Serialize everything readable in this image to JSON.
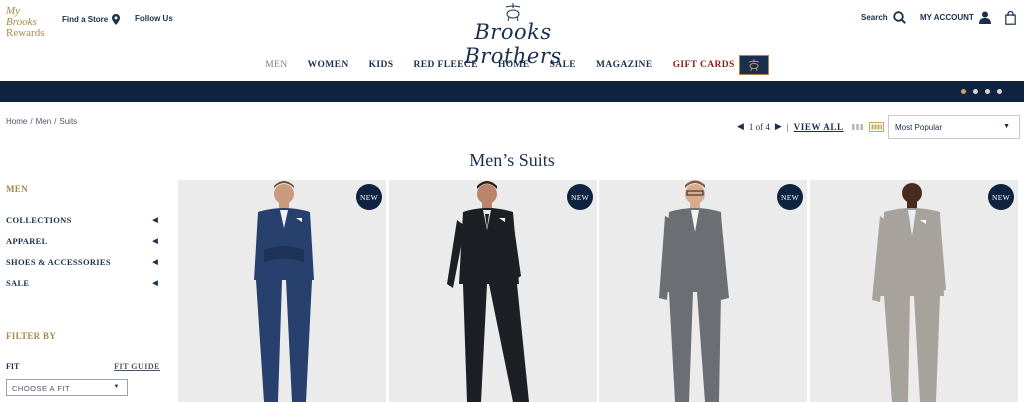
{
  "header": {
    "rewards": {
      "line1": "My Brooks",
      "line2": "Rewards"
    },
    "find_store": "Find a Store",
    "follow_us": "Follow Us",
    "logo": "Brooks Brothers",
    "search": "Search",
    "account": "MY ACCOUNT"
  },
  "nav": {
    "items": [
      "MEN",
      "WOMEN",
      "KIDS",
      "RED FLEECE",
      "HOME",
      "SALE",
      "MAGAZINE",
      "GIFT CARDS"
    ]
  },
  "promo": {
    "dots": 4,
    "active_dot": 0
  },
  "breadcrumb": [
    "Home",
    "/",
    "Men",
    "/",
    "Suits"
  ],
  "toolbar": {
    "pager": "1 of 4",
    "view_all": "VIEW ALL",
    "sort_value": "Most Popular"
  },
  "page_title": "Men’s Suits",
  "sidebar": {
    "heading": "MEN",
    "items": [
      "COLLECTIONS",
      "APPAREL",
      "SHOES & ACCESSORIES",
      "SALE"
    ],
    "filter_heading": "FILTER BY",
    "fit_label": "FIT",
    "fit_guide": "FIT GUIDE",
    "fit_placeholder": "CHOOSE A FIT"
  },
  "products": [
    {
      "badge": "NEW",
      "suit_color": "#27406e",
      "pose": "arms-crossed"
    },
    {
      "badge": "NEW",
      "suit_color": "#1c1f24",
      "pose": "walking"
    },
    {
      "badge": "NEW",
      "suit_color": "#6b6e72",
      "pose": "standing"
    },
    {
      "badge": "NEW",
      "suit_color": "#a7a39c",
      "pose": "standing"
    }
  ],
  "colors": {
    "navy": "#1b2f4d",
    "gold": "#a8884a",
    "promo_band": "#0e2340",
    "gift_red": "#8c1b1b"
  }
}
